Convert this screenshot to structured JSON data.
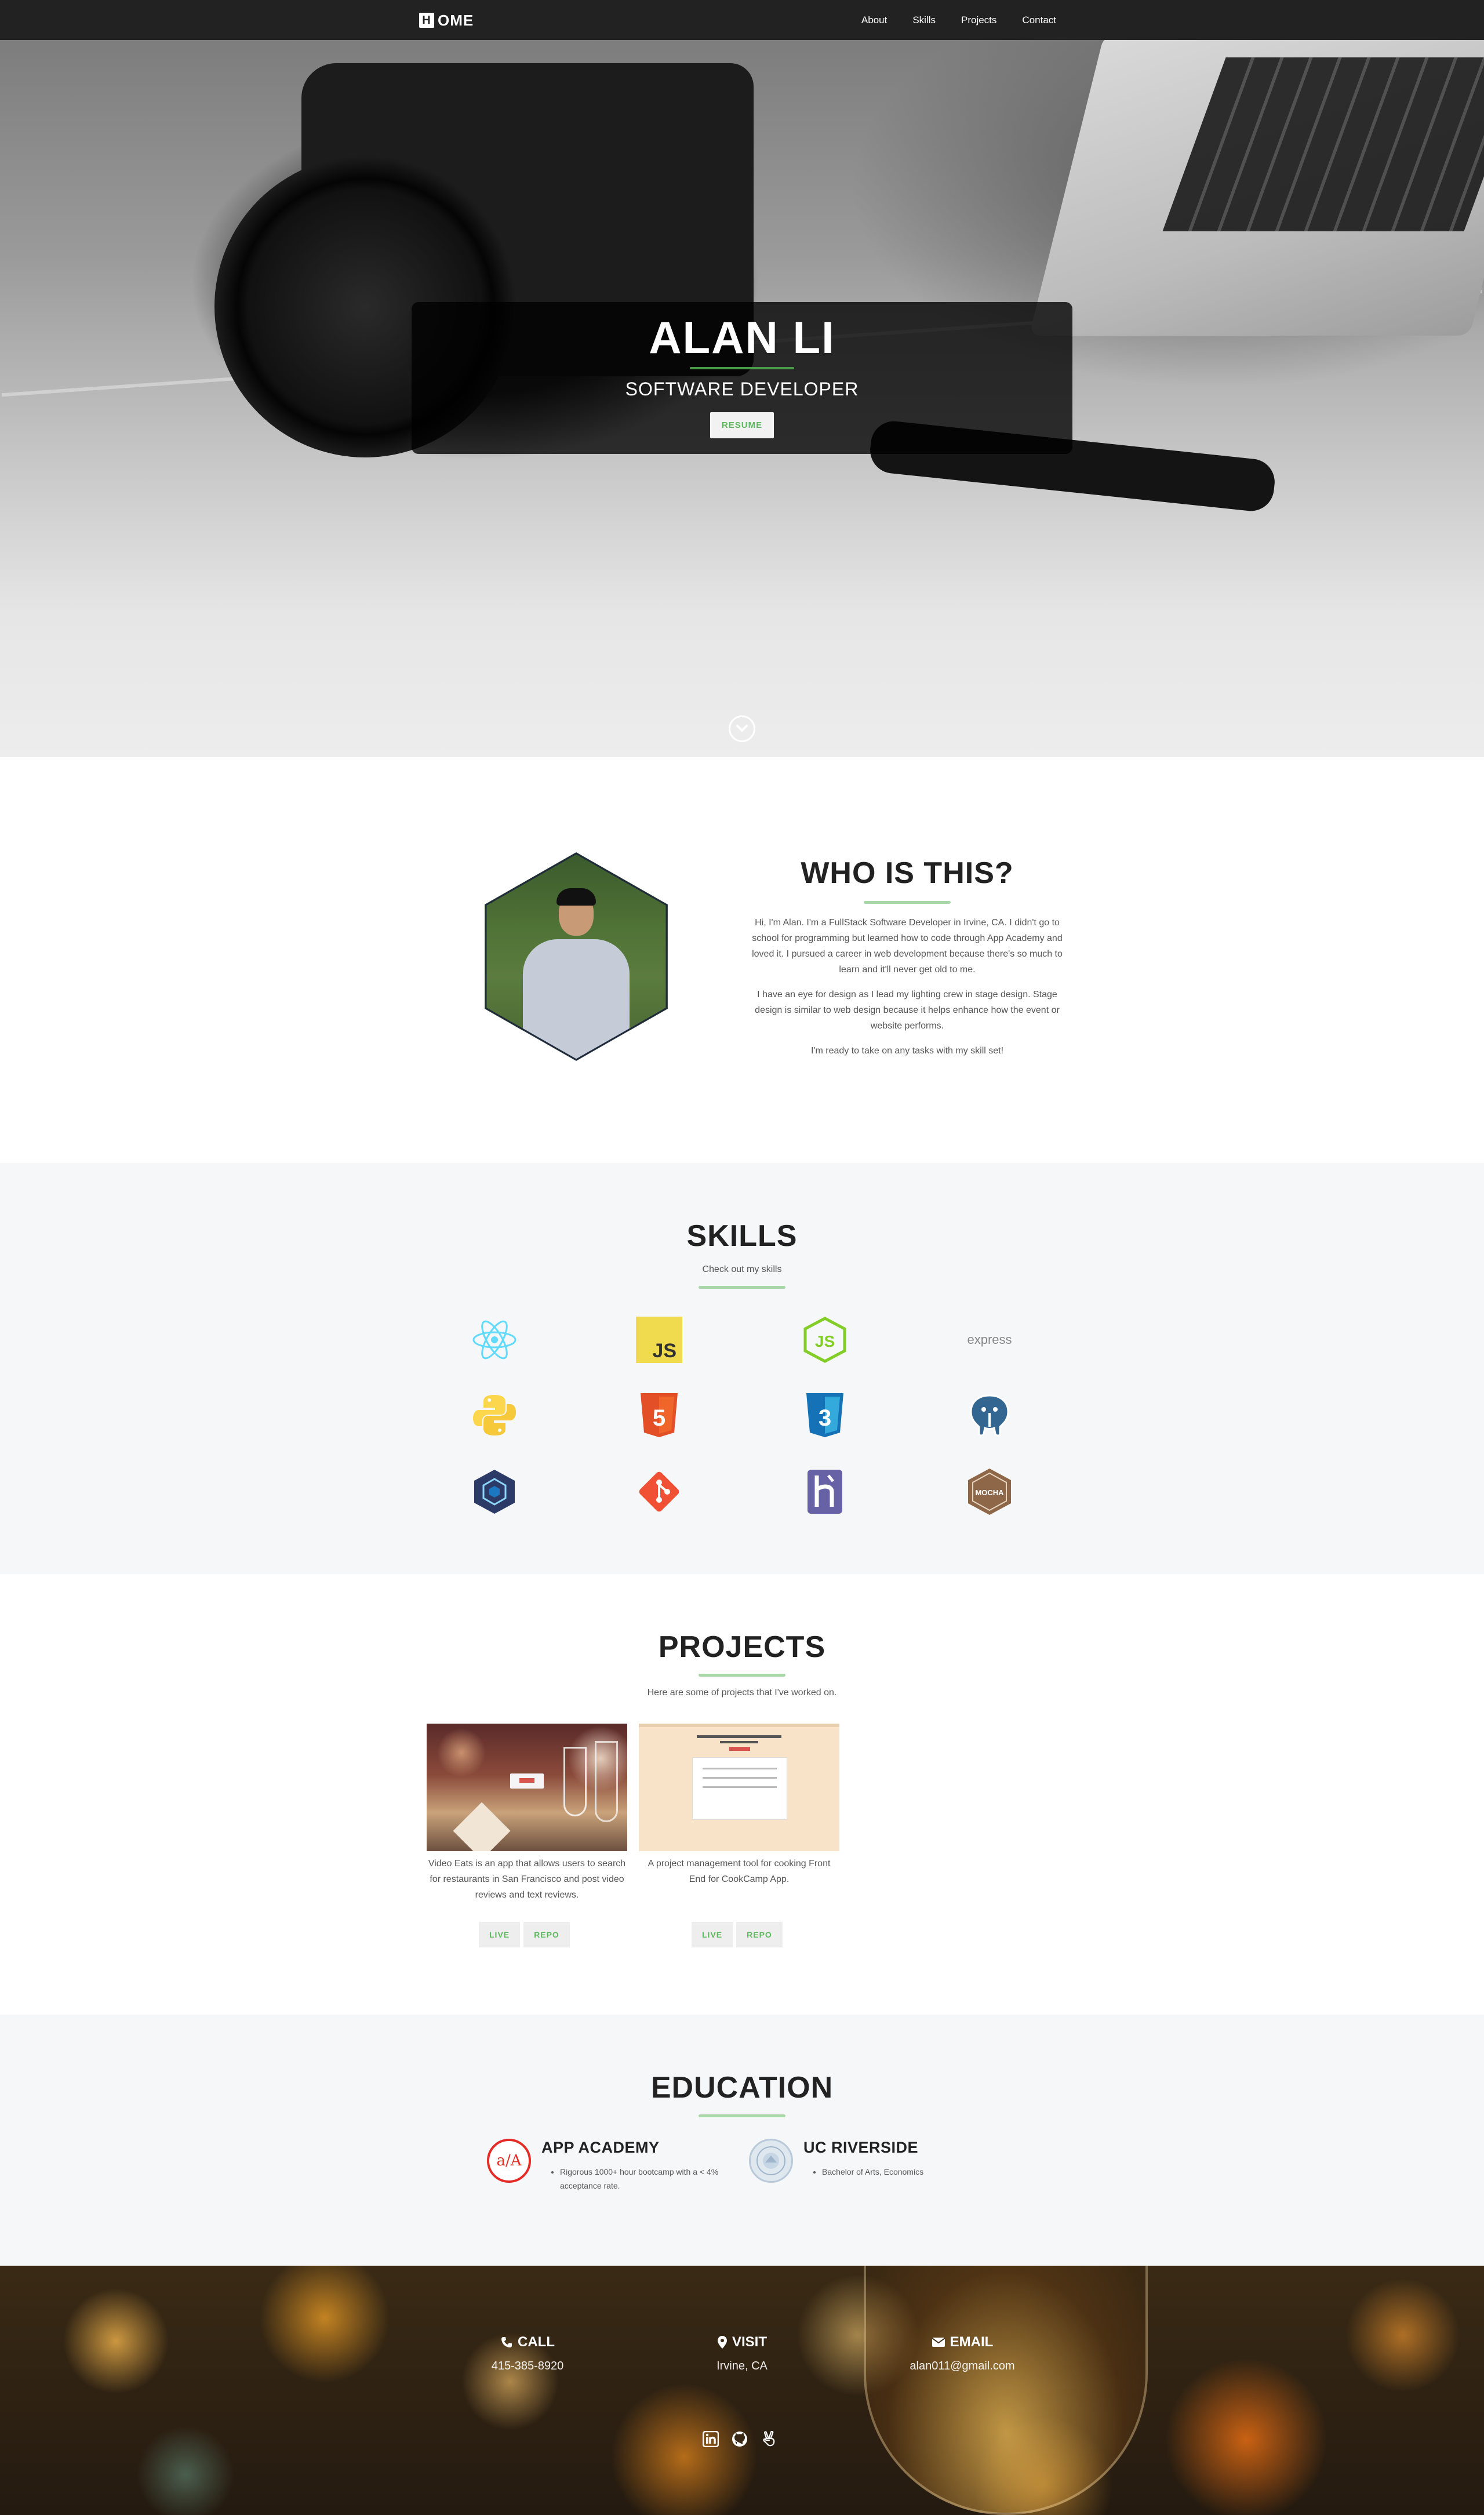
{
  "nav": {
    "brand_letter": "H",
    "brand_text": "OME",
    "links": [
      "About",
      "Skills",
      "Projects",
      "Contact"
    ]
  },
  "hero": {
    "name": "ALAN LI",
    "role": "SOFTWARE DEVELOPER",
    "button": "RESUME"
  },
  "about": {
    "title": "WHO IS THIS?",
    "paragraphs": [
      "Hi, I'm Alan. I'm a FullStack Software Developer in Irvine, CA. I didn't go to school for programming but learned how to code through App Academy and loved it. I pursued a career in web development because there's so much to learn and it'll never get old to me.",
      "I have an eye for design as I lead my lighting crew in stage design. Stage design is similar to web design because it helps enhance how the event or website performs.",
      "I'm ready to take on any tasks with my skill set!"
    ]
  },
  "skills": {
    "title": "SKILLS",
    "subtitle": "Check out my skills",
    "items": [
      {
        "name": "react-icon"
      },
      {
        "name": "javascript-icon",
        "label": "JS"
      },
      {
        "name": "nodejs-icon",
        "label": "JS"
      },
      {
        "name": "express-icon",
        "label": "express"
      },
      {
        "name": "python-icon"
      },
      {
        "name": "html5-icon",
        "label": "5"
      },
      {
        "name": "css3-icon",
        "label": "3"
      },
      {
        "name": "postgresql-icon"
      },
      {
        "name": "webpack-icon"
      },
      {
        "name": "git-icon"
      },
      {
        "name": "heroku-icon"
      },
      {
        "name": "mocha-icon",
        "label": "MOCHA"
      }
    ]
  },
  "projects": {
    "title": "PROJECTS",
    "subtitle": "Here are some of projects that I've worked on.",
    "items": [
      {
        "description": "Video Eats is an app that allows users to search for restaurants in San Francisco and post video reviews and text reviews.",
        "live": "LIVE",
        "repo": "REPO"
      },
      {
        "description": "A project management tool for cooking Front End for CookCamp App.",
        "live": "LIVE",
        "repo": "REPO"
      }
    ]
  },
  "education": {
    "title": "EDUCATION",
    "schools": [
      {
        "name": "APP ACADEMY",
        "logo_text": "a/A",
        "details": [
          "Rigorous 1000+ hour bootcamp with a < 4% acceptance rate."
        ]
      },
      {
        "name": "UC RIVERSIDE",
        "details": [
          "Bachelor of Arts, Economics"
        ]
      }
    ]
  },
  "contact": {
    "call_label": "CALL",
    "call_value": "415-385-8920",
    "visit_label": "VISIT",
    "visit_value": "Irvine, CA",
    "email_label": "EMAIL",
    "email_value": "alan011@gmail.com"
  },
  "colors": {
    "nav_bg": "#222222",
    "accent_green": "#5cb85c",
    "rule_green": "#a8d8a8",
    "section_alt_bg": "#f6f7f8"
  }
}
